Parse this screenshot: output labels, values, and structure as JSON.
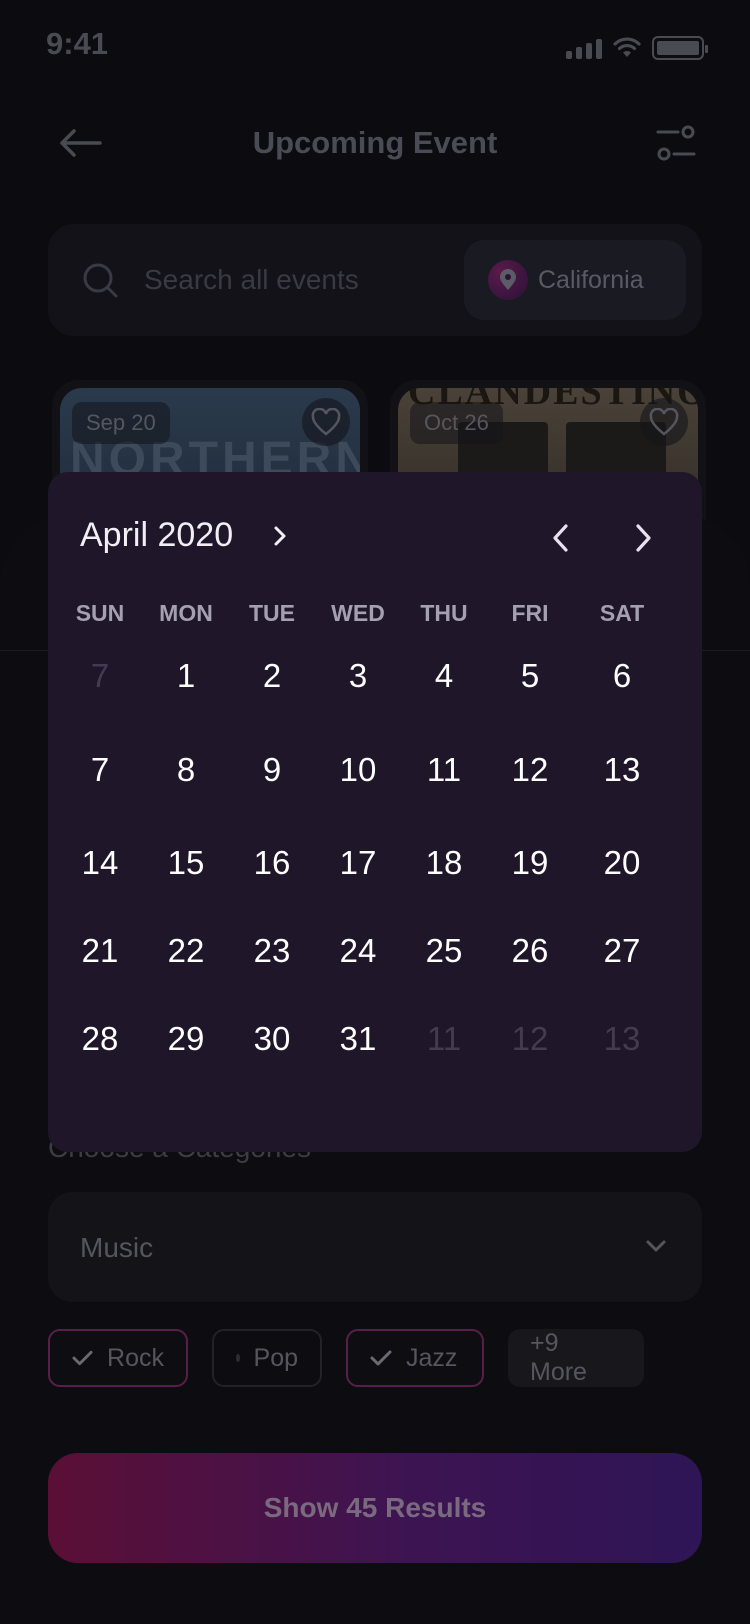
{
  "status_bar": {
    "time": "9:41"
  },
  "header": {
    "title": "Upcoming Event",
    "back_icon": "arrow-left-icon",
    "filter_icon": "sliders-icon"
  },
  "search": {
    "placeholder": "Search all events",
    "location": "California"
  },
  "events": [
    {
      "date": "Sep 20",
      "art_text": "NORTHERN"
    },
    {
      "date": "Oct 26",
      "art_text": "CLANDESTINO"
    }
  ],
  "filters": {
    "categories_label": "Choose a Categories",
    "category_value": "Music",
    "chips": [
      {
        "label": "Rock",
        "selected": true
      },
      {
        "label": "Pop",
        "selected": false
      },
      {
        "label": "Jazz",
        "selected": true
      },
      {
        "label": "+9 More",
        "selected": false
      }
    ],
    "results_button": "Show 45 Results"
  },
  "calendar": {
    "month_label": "April 2020",
    "weekdays": [
      "SUN",
      "MON",
      "TUE",
      "WED",
      "THU",
      "FRI",
      "SAT"
    ],
    "weeks": [
      [
        "7",
        "1",
        "2",
        "3",
        "4",
        "5",
        "6"
      ],
      [
        "7",
        "8",
        "9",
        "10",
        "11",
        "12",
        "13"
      ],
      [
        "14",
        "15",
        "16",
        "17",
        "18",
        "19",
        "20"
      ],
      [
        "21",
        "22",
        "23",
        "24",
        "25",
        "26",
        "27"
      ],
      [
        "28",
        "29",
        "30",
        "31",
        "11",
        "12",
        "13"
      ]
    ],
    "faded": [
      [
        0,
        0
      ],
      [
        4,
        4
      ],
      [
        4,
        5
      ],
      [
        4,
        6
      ]
    ]
  },
  "colors": {
    "calendar_bg": "#1f1629",
    "accent_start": "#5b0f36",
    "accent_end": "#2e1556"
  }
}
